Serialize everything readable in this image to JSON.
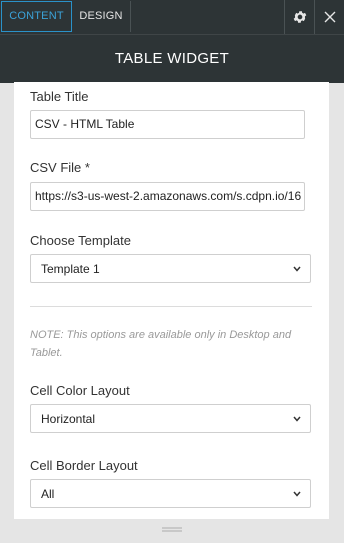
{
  "tabs": {
    "content": "CONTENT",
    "design": "DESIGN"
  },
  "header": {
    "title": "TABLE WIDGET"
  },
  "fields": {
    "table_title": {
      "label": "Table Title",
      "value": "CSV - HTML Table"
    },
    "csv_file": {
      "label": "CSV File *",
      "value": "https://s3-us-west-2.amazonaws.com/s.cdpn.io/16"
    },
    "template": {
      "label": "Choose Template",
      "value": "Template 1"
    },
    "note": "NOTE: This options are available only in Desktop and Tablet.",
    "cell_color": {
      "label": "Cell Color Layout",
      "value": "Horizontal"
    },
    "cell_border": {
      "label": "Cell Border Layout",
      "value": "All"
    }
  },
  "icons": {
    "settings": "gear-icon",
    "close": "close-icon",
    "chevron": "chevron-down-icon",
    "resize": "resize-handle-icon"
  },
  "colors": {
    "topbar": "#2d3436",
    "accent": "#2a92c9"
  }
}
